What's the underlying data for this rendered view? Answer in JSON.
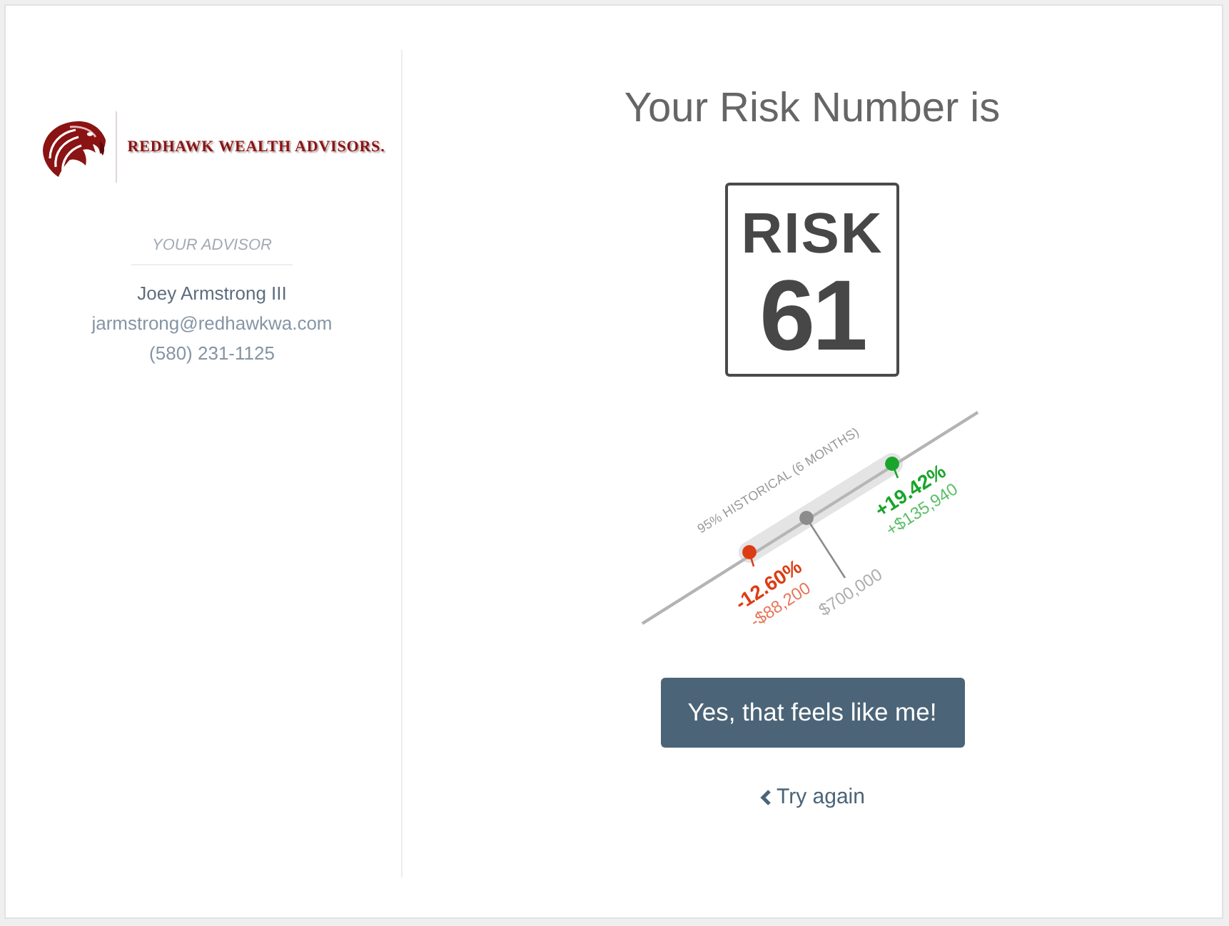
{
  "logo": {
    "text": "REDHAWK WEALTH ADVISORS."
  },
  "advisor": {
    "heading": "YOUR ADVISOR",
    "name": "Joey Armstrong III",
    "email": "jarmstrong@redhawkwa.com",
    "phone": "(580) 231-1125"
  },
  "title": "Your Risk Number is",
  "risk_sign": {
    "word": "RISK",
    "number": "61"
  },
  "risk_range": {
    "label": "95% HISTORICAL (6 MONTHS)",
    "markers": [
      {
        "kind": "low",
        "color": "#dc3c14",
        "percent": "-12.60%",
        "amount": "-$88,200"
      },
      {
        "kind": "current",
        "color": "#8c8c8c",
        "amount": "$700,000"
      },
      {
        "kind": "high",
        "color": "#19a52a",
        "percent": "+19.42%",
        "amount": "+$135,940"
      }
    ]
  },
  "confirm_button": "Yes, that feels like me!",
  "retry_link": "Try again"
}
